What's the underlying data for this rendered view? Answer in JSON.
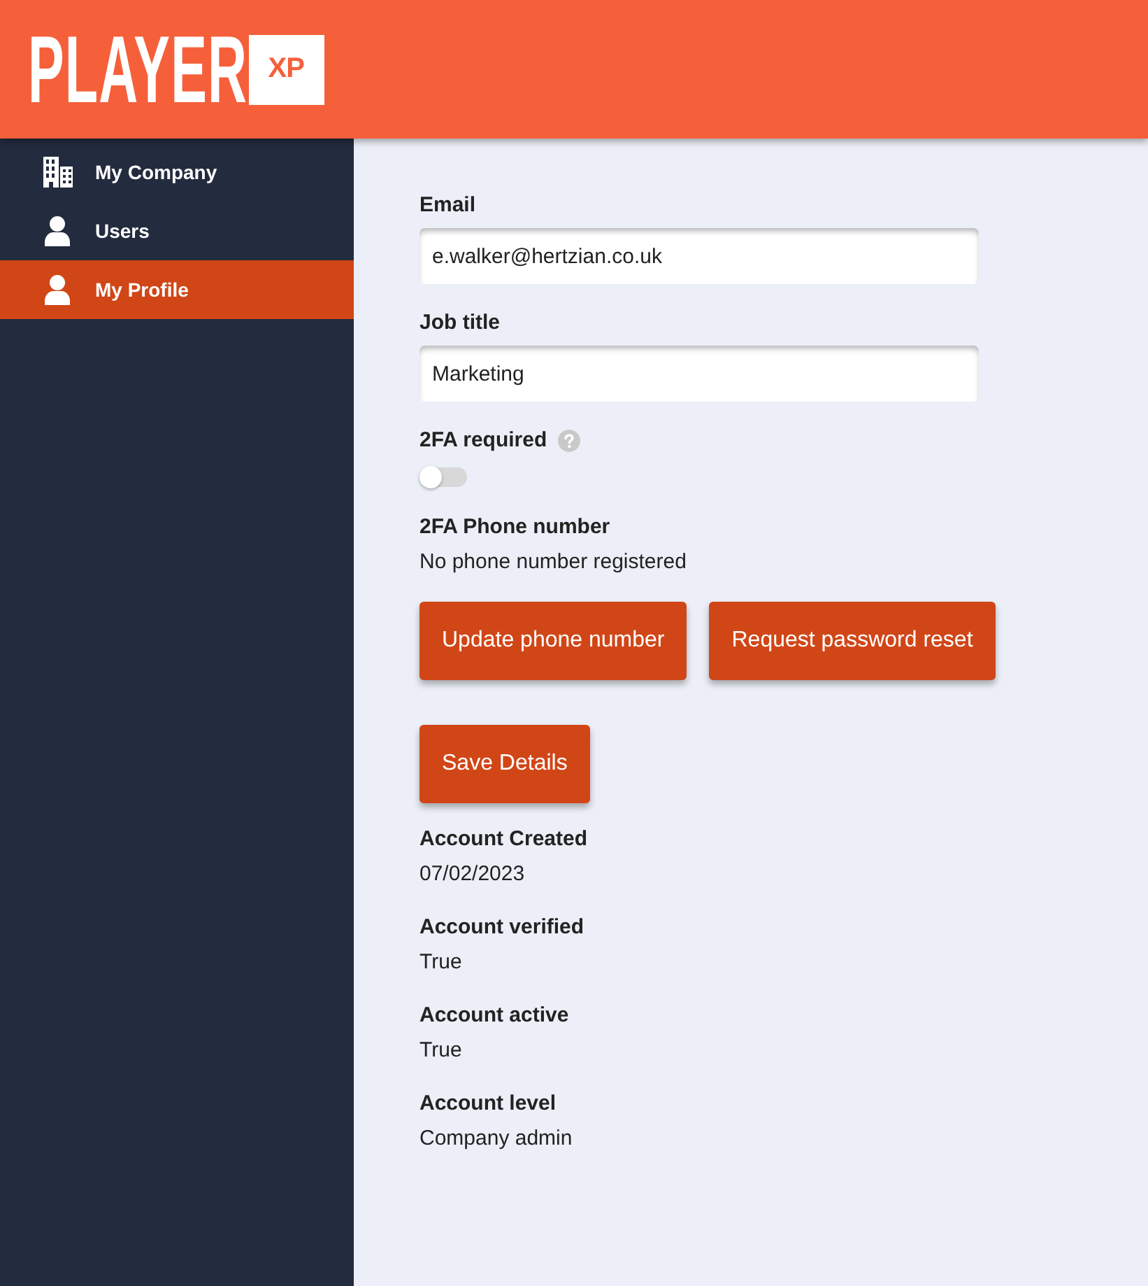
{
  "header": {
    "logo": {
      "text": "PLAYER",
      "badge": "XP"
    }
  },
  "sidebar": {
    "items": [
      {
        "label": "My Company",
        "kind": "company",
        "selected": false
      },
      {
        "label": "Users",
        "kind": "user",
        "selected": false
      },
      {
        "label": "My Profile",
        "kind": "user",
        "selected": true
      }
    ]
  },
  "form": {
    "fields": [
      {
        "kind": "input",
        "label": "Email",
        "value": "e.walker@hertzian.co.uk"
      },
      {
        "kind": "input",
        "label": "Job title",
        "value": "Marketing"
      },
      {
        "kind": "toggle",
        "label": "2FA required",
        "help": true,
        "on": false
      },
      {
        "kind": "text",
        "label": "2FA Phone number",
        "value": "No phone number registered"
      }
    ],
    "buttons": [
      "Update phone number",
      "Request password reset"
    ],
    "save_button": "Save Details",
    "details": [
      {
        "label": "Account Created",
        "value": "07/02/2023"
      },
      {
        "label": "Account verified",
        "value": "True"
      },
      {
        "label": "Account active",
        "value": "True"
      },
      {
        "label": "Account level",
        "value": "Company admin"
      }
    ]
  }
}
